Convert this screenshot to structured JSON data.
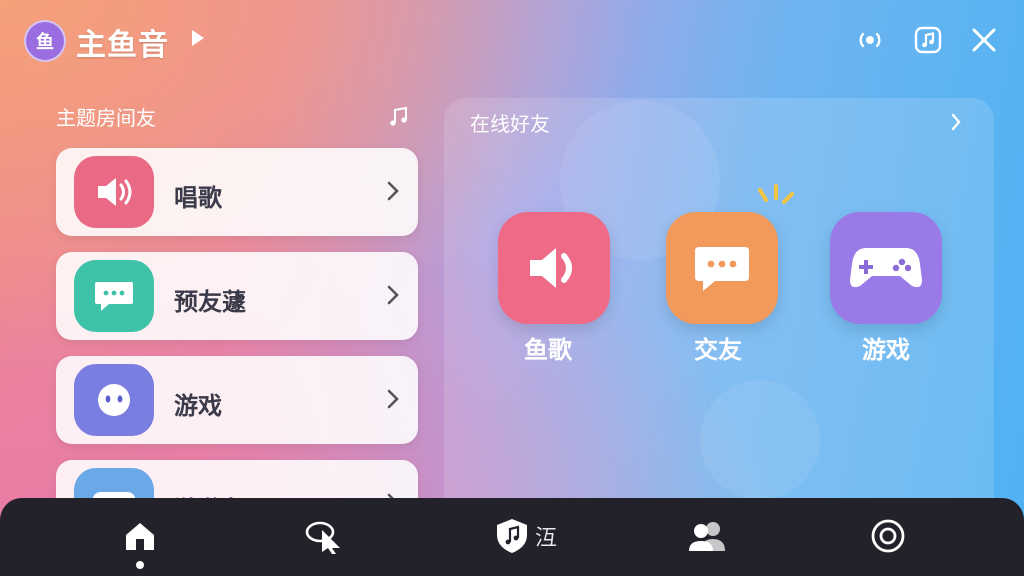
{
  "header": {
    "app_badge": "鱼",
    "title": "主鱼音"
  },
  "left": {
    "heading": "主题房间友",
    "items": [
      {
        "label": "唱歌",
        "icon": "speaker-icon",
        "color": "#ea6a86"
      },
      {
        "label": "预友蘧",
        "icon": "chat-bubble-icon",
        "color": "#3ec2a8"
      },
      {
        "label": "游戏",
        "icon": "face-icon",
        "color": "#7a7ee0"
      },
      {
        "label": "游滟友",
        "icon": "gamepad-icon",
        "color": "#6aa8e8"
      }
    ]
  },
  "right": {
    "heading": "在线好友",
    "tiles": [
      {
        "label": "鱼歌",
        "icon": "speaker-icon",
        "color": "#ee6a86"
      },
      {
        "label": "交友",
        "icon": "chat-bubble-icon",
        "color": "#f29a5c"
      },
      {
        "label": "游戏",
        "icon": "gamepad-icon",
        "color": "#9a7ae6"
      }
    ]
  },
  "bottom_nav": {
    "items": [
      {
        "icon": "home-icon",
        "active": true
      },
      {
        "icon": "cursor-icon"
      },
      {
        "icon": "music-shield-icon",
        "label": "沍"
      },
      {
        "icon": "friends-icon"
      },
      {
        "icon": "target-icon"
      }
    ]
  },
  "colors": {
    "nav_bg": "#23222a",
    "badge": "#9a6ee0"
  }
}
